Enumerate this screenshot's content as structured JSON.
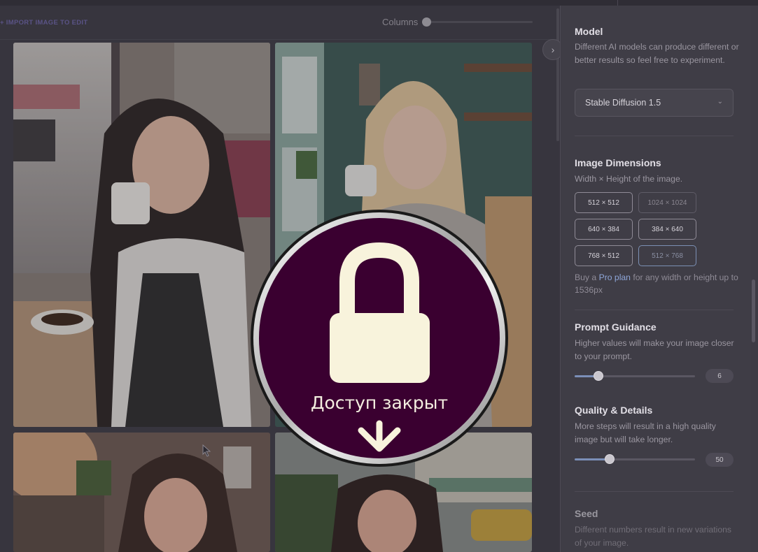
{
  "toolbar": {
    "import_label": "+ IMPORT IMAGE TO EDIT",
    "columns_label": "Columns",
    "collapse_icon": "chevron-right-icon"
  },
  "gallery": {
    "images": [
      {
        "name": "generated-image-1"
      },
      {
        "name": "generated-image-2"
      },
      {
        "name": "generated-image-3"
      },
      {
        "name": "generated-image-4"
      }
    ]
  },
  "settings": {
    "model": {
      "title": "Model",
      "description": "Different AI models can produce different or better results so feel free to experiment.",
      "selected": "Stable Diffusion 1.5"
    },
    "dimensions": {
      "title": "Image Dimensions",
      "description": "Width × Height of the image.",
      "options": [
        {
          "label": "512 × 512",
          "state": "normal"
        },
        {
          "label": "1024 × 1024",
          "state": "disabled"
        },
        {
          "label": "640 × 384",
          "state": "normal"
        },
        {
          "label": "384 × 640",
          "state": "normal"
        },
        {
          "label": "768 × 512",
          "state": "normal"
        },
        {
          "label": "512 × 768",
          "state": "selected"
        }
      ],
      "pro_prefix": "Buy a ",
      "pro_link": "Pro plan",
      "pro_suffix": " for any width or height up to 1536px"
    },
    "guidance": {
      "title": "Prompt Guidance",
      "description": "Higher values will make your image closer to your prompt.",
      "value": "6",
      "level": 0.2
    },
    "quality": {
      "title": "Quality & Details",
      "description": "More steps will result in a high quality image but will take longer.",
      "value": "50",
      "level": 0.29
    },
    "seed": {
      "title": "Seed",
      "description": "Different numbers result in new variations of your image."
    }
  },
  "overlay": {
    "lock_text": "Доступ закрыт",
    "lock_icon": "padlock-icon",
    "arrow_icon": "arrow-down-icon",
    "colors": {
      "badge": "#3a0030",
      "glyph": "#f8f3dc"
    }
  }
}
